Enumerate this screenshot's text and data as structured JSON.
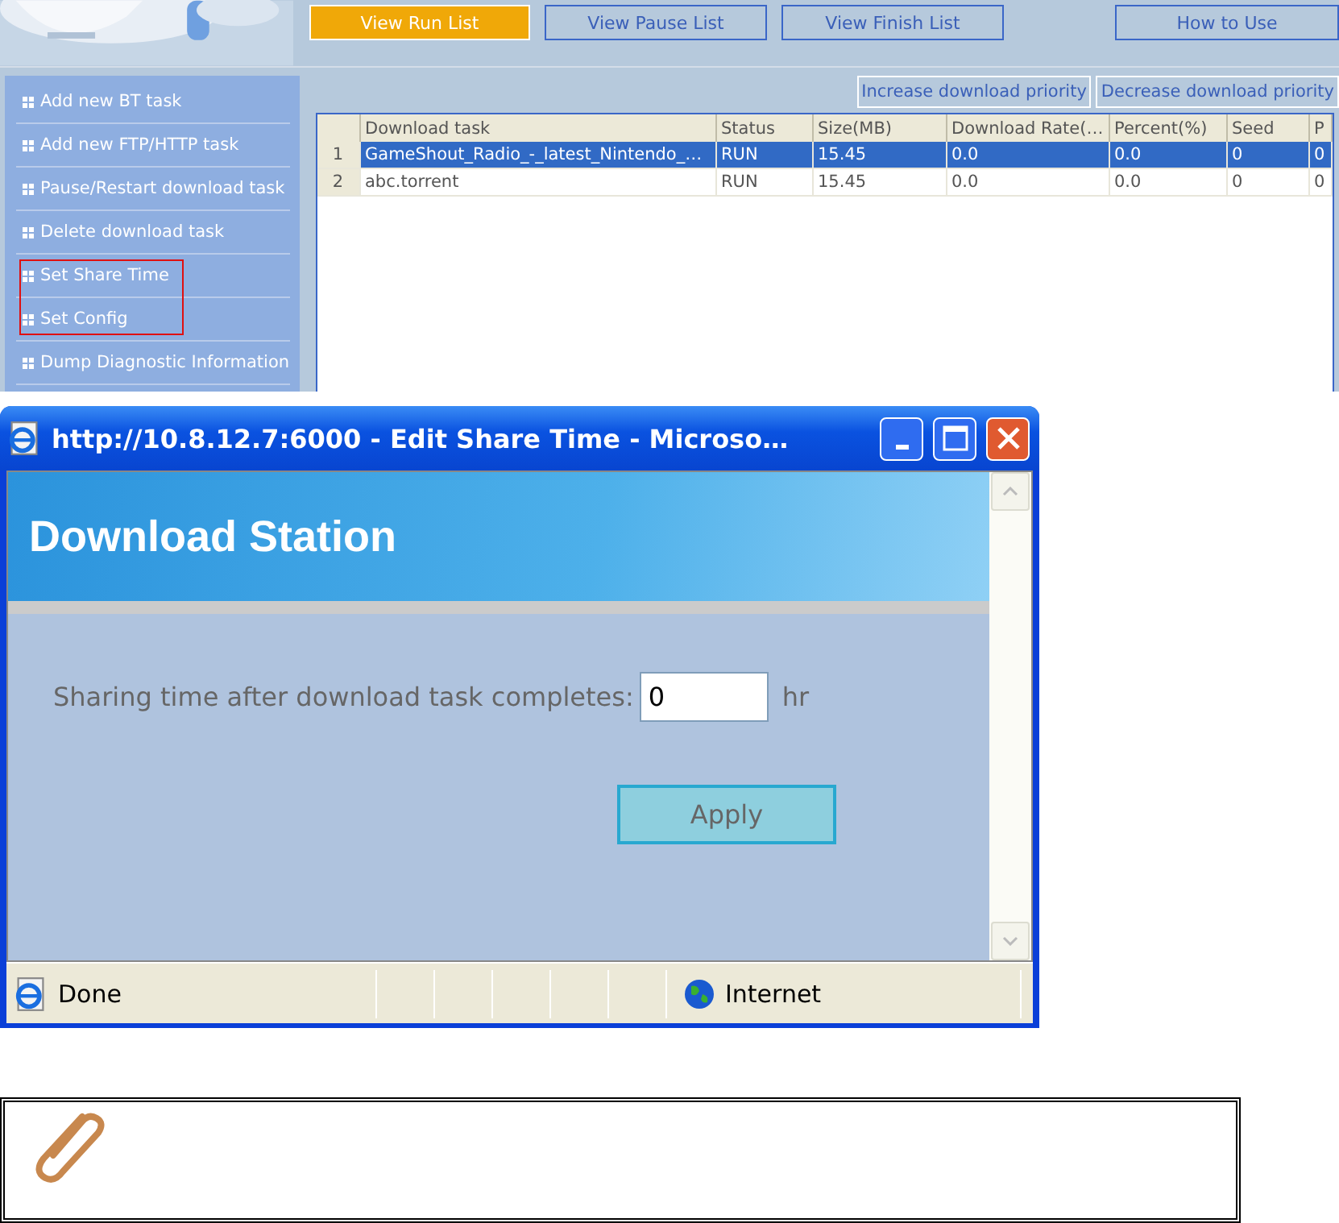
{
  "main_app": {
    "nav_buttons": [
      {
        "label": "View Run List",
        "selected": true
      },
      {
        "label": "View Pause List",
        "selected": false
      },
      {
        "label": "View Finish List",
        "selected": false
      },
      {
        "label": "How to Use",
        "selected": false
      }
    ],
    "sidebar": {
      "items": [
        {
          "label": "Add new BT task",
          "marked": false
        },
        {
          "label": "Add new FTP/HTTP task",
          "marked": false
        },
        {
          "label": "Pause/Restart download task",
          "marked": false
        },
        {
          "label": "Delete download task",
          "marked": false
        },
        {
          "label": "Set Share Time",
          "marked": true
        },
        {
          "label": "Set Config",
          "marked": true
        },
        {
          "label": "Dump Diagnostic Information",
          "marked": false
        }
      ]
    },
    "priority_buttons": [
      "Increase download priority",
      "Decrease download priority"
    ],
    "table": {
      "columns": [
        "",
        "Download task",
        "Status",
        "Size(MB)",
        "Download Rate(…",
        "Percent(%)",
        "Seed",
        "P"
      ],
      "rows": [
        {
          "selected": true,
          "cells": [
            "1",
            "GameShout_Radio_-_latest_Nintendo_…",
            "RUN",
            "15.45",
            "0.0",
            "0.0",
            "0",
            "0"
          ]
        },
        {
          "selected": false,
          "cells": [
            "2",
            "abc.torrent",
            "RUN",
            "15.45",
            "0.0",
            "0.0",
            "0",
            "0"
          ]
        }
      ]
    }
  },
  "popup": {
    "title": "http://10.8.12.7:6000 - Edit Share Time - Microso…",
    "header": "Download Station",
    "field": {
      "label": "Sharing time after download task completes:",
      "value": "0",
      "unit": "hr"
    },
    "apply_button": "Apply",
    "status_bar": {
      "status": "Done",
      "zone": "Internet"
    }
  }
}
